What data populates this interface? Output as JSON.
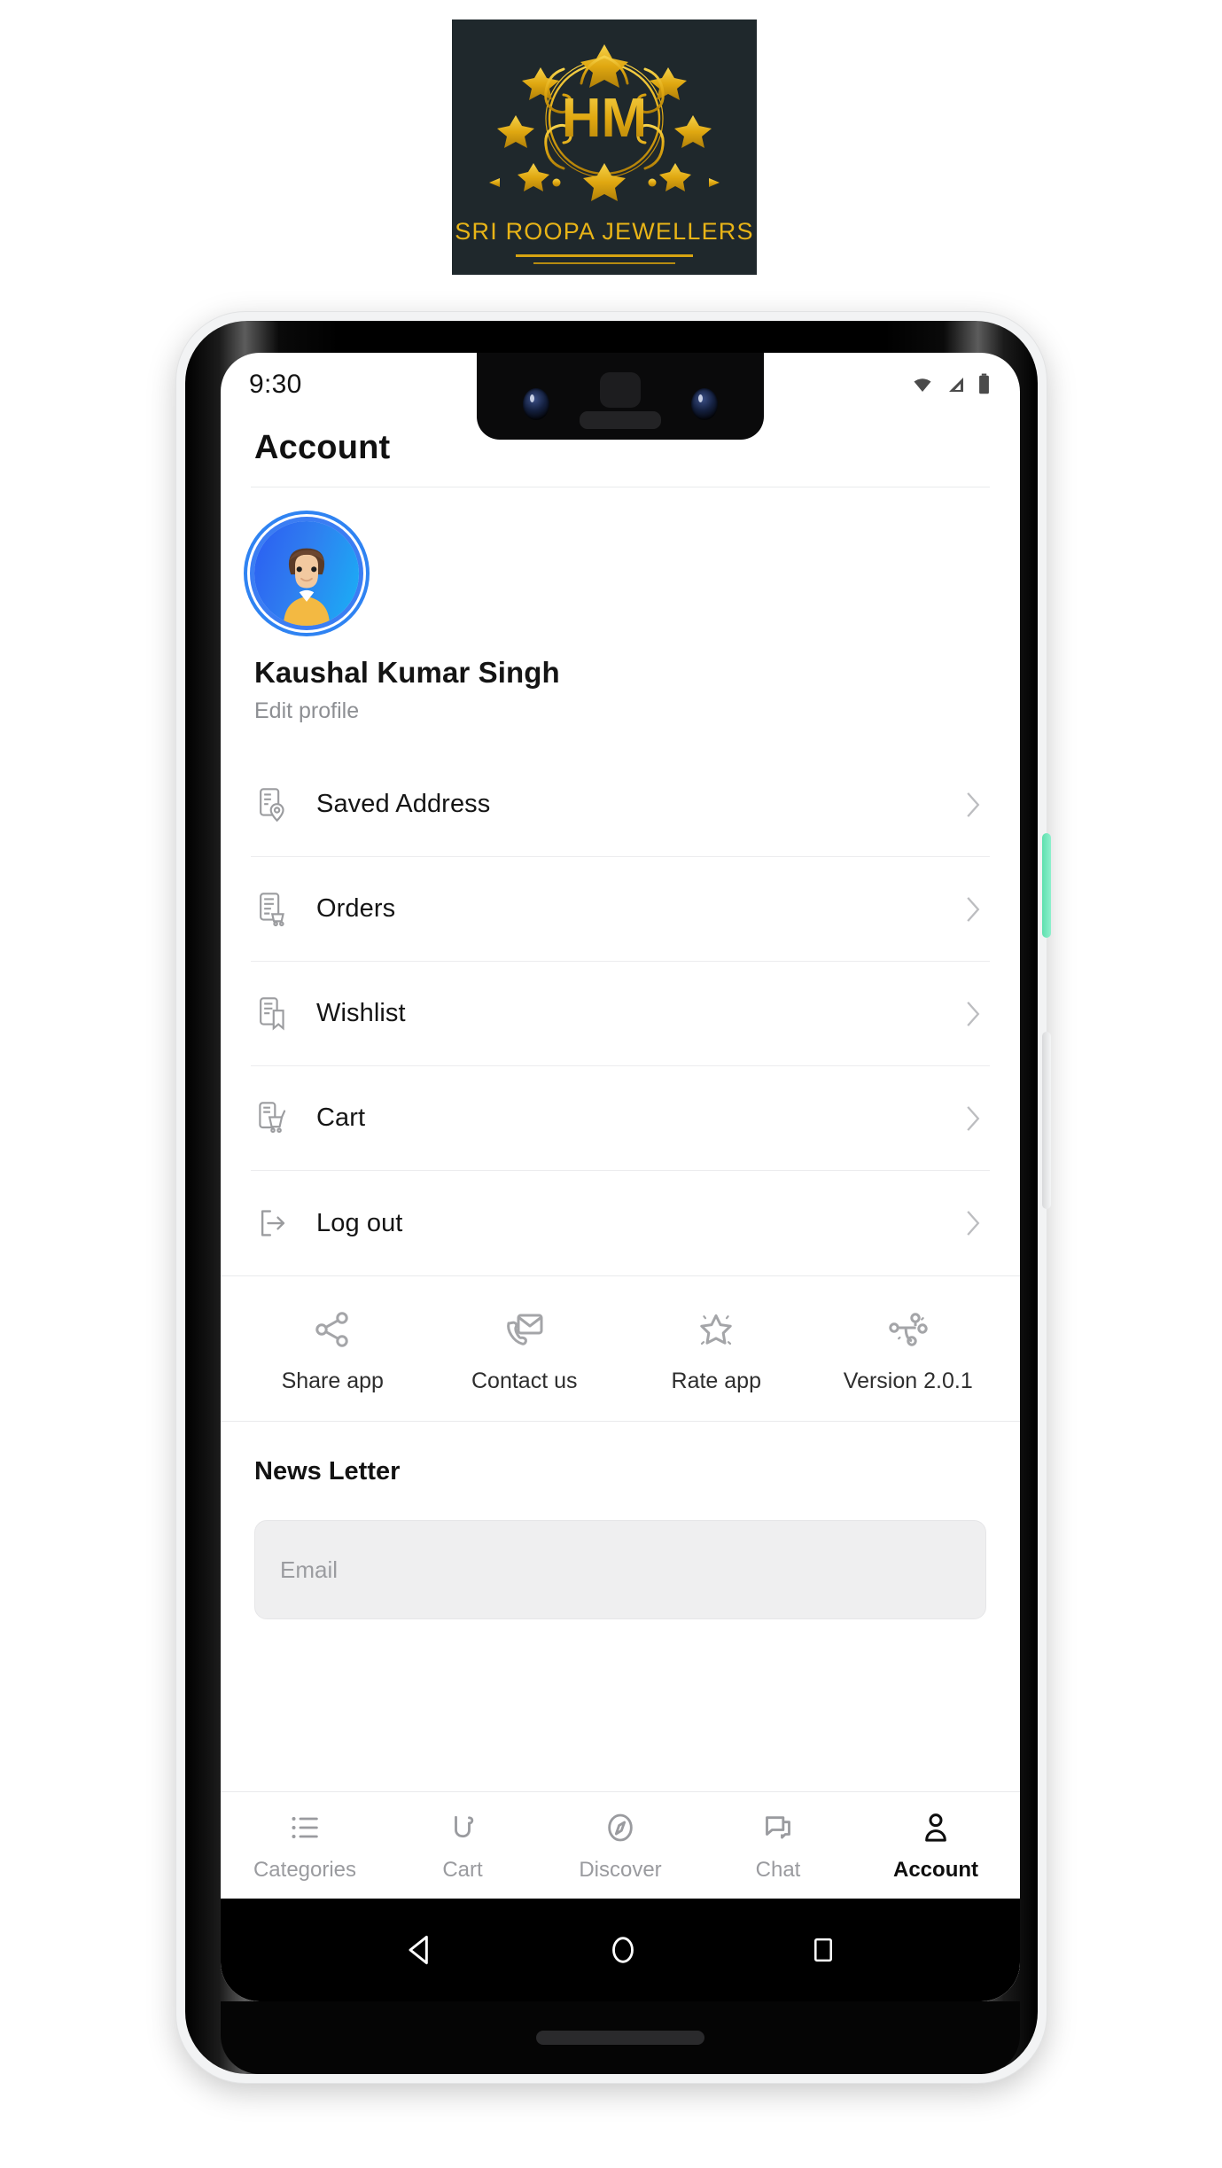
{
  "brand": {
    "monogram": "HM",
    "name": "SRI ROOPA JEWELLERS",
    "bg_color": "#1f282c",
    "gold_color": "#e8b417"
  },
  "phone": {
    "statusbar": {
      "time": "9:30",
      "icons": [
        "wifi-icon",
        "signal-icon",
        "battery-icon"
      ]
    },
    "android_nav": [
      "back-button",
      "home-button",
      "recents-button"
    ],
    "side_buttons": {
      "power_color": "#6fe6b8",
      "volume_color": "#e6e7e9"
    }
  },
  "screen": {
    "title": "Account",
    "profile": {
      "name": "Kaushal Kumar Singh",
      "edit_label": "Edit profile",
      "avatar_icon": "user-avatar"
    },
    "menu": [
      {
        "label": "Saved Address",
        "icon": "saved-address-icon"
      },
      {
        "label": "Orders",
        "icon": "orders-icon"
      },
      {
        "label": "Wishlist",
        "icon": "wishlist-icon"
      },
      {
        "label": "Cart",
        "icon": "cart-icon"
      },
      {
        "label": "Log out",
        "icon": "logout-icon"
      }
    ],
    "actions": [
      {
        "label": "Share app",
        "icon": "share-icon"
      },
      {
        "label": "Contact us",
        "icon": "contact-icon"
      },
      {
        "label": "Rate app",
        "icon": "star-icon"
      },
      {
        "label": "Version 2.0.1",
        "icon": "version-icon"
      }
    ],
    "newsletter": {
      "title": "News Letter",
      "email_placeholder": "Email",
      "email_value": ""
    },
    "bottom_nav": [
      {
        "label": "Categories",
        "icon": "list-icon",
        "active": false
      },
      {
        "label": "Cart",
        "icon": "cart-nav-icon",
        "active": false
      },
      {
        "label": "Discover",
        "icon": "compass-icon",
        "active": false
      },
      {
        "label": "Chat",
        "icon": "chat-icon",
        "active": false
      },
      {
        "label": "Account",
        "icon": "person-icon",
        "active": true
      }
    ]
  }
}
